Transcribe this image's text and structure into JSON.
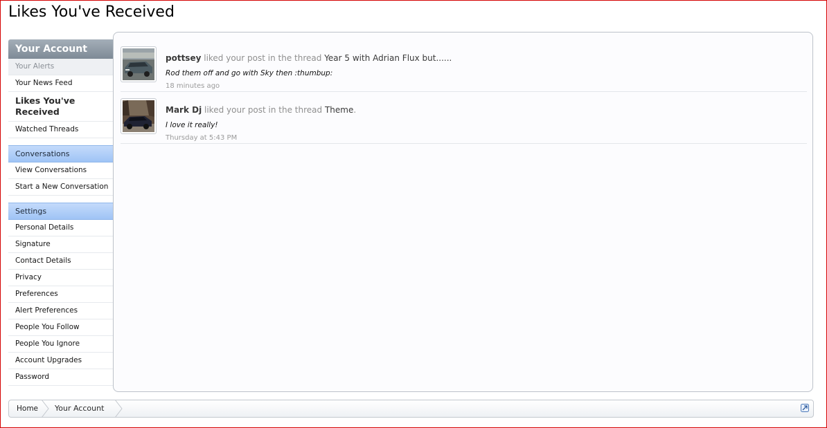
{
  "page": {
    "title": "Likes You've Received"
  },
  "sidebar": {
    "heading": "Your Account",
    "account_items": [
      {
        "label": "Your Alerts"
      },
      {
        "label": "Your News Feed"
      },
      {
        "label": "Likes You've Received"
      },
      {
        "label": "Watched Threads"
      }
    ],
    "conversations": {
      "heading": "Conversations",
      "items": [
        {
          "label": "View Conversations"
        },
        {
          "label": "Start a New Conversation"
        }
      ]
    },
    "settings": {
      "heading": "Settings",
      "items": [
        {
          "label": "Personal Details"
        },
        {
          "label": "Signature"
        },
        {
          "label": "Contact Details"
        },
        {
          "label": "Privacy"
        },
        {
          "label": "Preferences"
        },
        {
          "label": "Alert Preferences"
        },
        {
          "label": "People You Follow"
        },
        {
          "label": "People You Ignore"
        },
        {
          "label": "Account Upgrades"
        },
        {
          "label": "Password"
        }
      ]
    }
  },
  "likes": [
    {
      "user": "pottsey",
      "action": " liked your post in the thread ",
      "thread": "Year 5 with Adrian Flux but......",
      "suffix": "",
      "quote": "Rod them off and go with Sky then :thumbup:",
      "time": "18 minutes ago"
    },
    {
      "user": "Mark Dj",
      "action": " liked your post in the thread ",
      "thread": "Theme",
      "suffix": ".",
      "quote": "I love it really!",
      "time": "Thursday at 5:43 PM"
    }
  ],
  "breadcrumb": {
    "home": "Home",
    "current": "Your Account"
  },
  "colors": {
    "sidebar_heading": "#8a96a2",
    "section_heading": "#aecdf7",
    "frame_border": "#d40000"
  }
}
